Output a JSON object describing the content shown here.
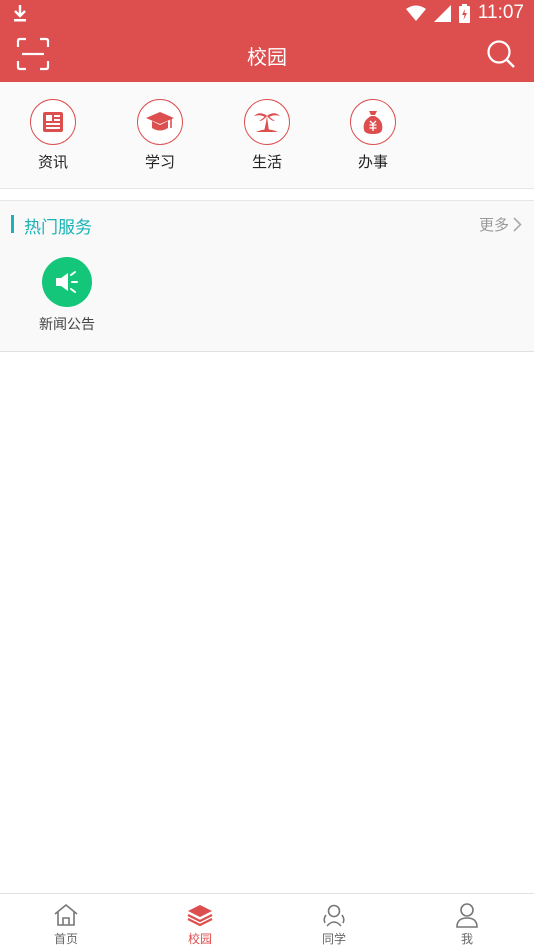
{
  "status_bar": {
    "time": "11:07"
  },
  "header": {
    "title": "校园"
  },
  "categories": [
    {
      "label": "资讯",
      "icon": "news-icon"
    },
    {
      "label": "学习",
      "icon": "graduation-cap-icon"
    },
    {
      "label": "生活",
      "icon": "palm-tree-icon"
    },
    {
      "label": "办事",
      "icon": "money-bag-icon"
    }
  ],
  "hot_services": {
    "title": "热门服务",
    "more_label": "更多",
    "items": [
      {
        "label": "新闻公告",
        "icon": "megaphone-icon"
      }
    ]
  },
  "tabbar": {
    "items": [
      {
        "label": "首页",
        "icon": "home-icon"
      },
      {
        "label": "校园",
        "icon": "layers-icon",
        "active": true
      },
      {
        "label": "同学",
        "icon": "classmates-icon"
      },
      {
        "label": "我",
        "icon": "user-icon"
      }
    ]
  },
  "colors": {
    "primary": "#dd4e4f",
    "accent": "#19b3b5",
    "service_green": "#13c679"
  }
}
